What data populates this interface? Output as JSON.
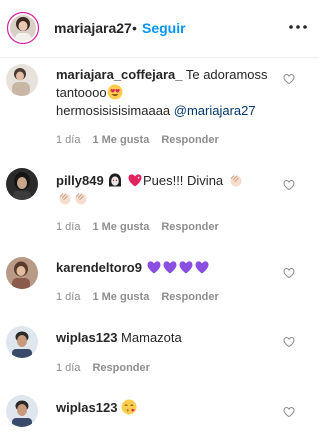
{
  "header": {
    "username": "mariajara27",
    "separator": "•",
    "follow_label": "Seguir",
    "more_icon": "more-horizontal-icon"
  },
  "colors": {
    "follow": "#0095f6",
    "mention": "#00376b",
    "meta": "#8e8e8e",
    "heart_purple": "#8a4fe0"
  },
  "comments": [
    {
      "username": "mariajara_coffejara_",
      "text": " Te adoramoss tantoooo",
      "line2": "hermosisisisimaaaa ",
      "mention": "@mariajara27",
      "time": "1 día",
      "likes": "1 Me gusta",
      "reply": "Responder"
    },
    {
      "username": "pilly849",
      "text_after": "Pues!!! Divina",
      "time": "1 día",
      "likes": "1 Me gusta",
      "reply": "Responder"
    },
    {
      "username": "karendeltoro9",
      "time": "1 día",
      "likes": "1 Me gusta",
      "reply": "Responder"
    },
    {
      "username": "wiplas123",
      "text": " Mamazota",
      "time": "1 día",
      "reply": "Responder"
    },
    {
      "username": "wiplas123"
    }
  ]
}
